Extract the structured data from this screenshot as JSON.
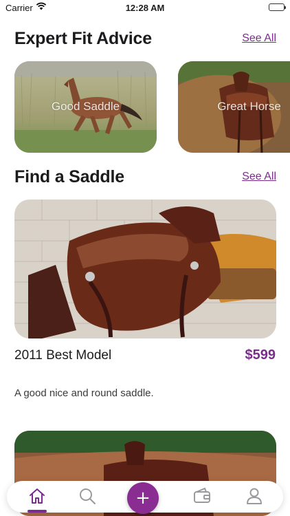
{
  "status_bar": {
    "carrier": "Carrier",
    "time": "12:28 AM"
  },
  "sections": {
    "expert": {
      "title": "Expert Fit Advice",
      "see_all": "See All"
    },
    "find": {
      "title": "Find a Saddle",
      "see_all": "See All"
    }
  },
  "advice_cards": [
    {
      "label": "Good Saddle"
    },
    {
      "label": "Great Horse"
    }
  ],
  "product": {
    "name": "2011 Best Model",
    "price": "$599",
    "description": "A good nice and round saddle."
  },
  "tab_bar": {
    "active": "home",
    "fab_label": "+",
    "icons": [
      "home-icon",
      "search-icon",
      "add-icon",
      "wallet-icon",
      "profile-icon"
    ]
  },
  "colors": {
    "accent": "#7b2d8e",
    "fab": "#8a2d92"
  }
}
